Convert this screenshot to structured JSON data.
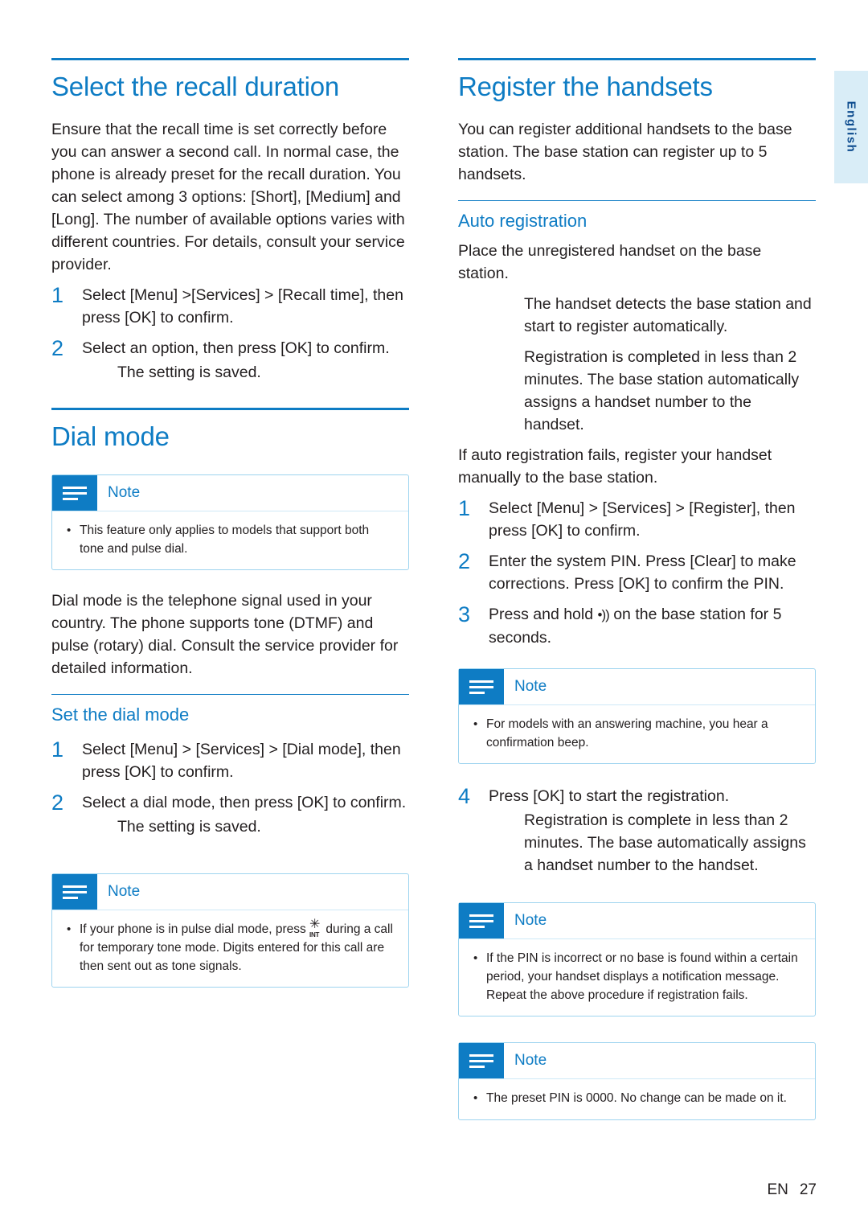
{
  "language_tab": "English",
  "footer": {
    "locale": "EN",
    "page": "27"
  },
  "note_label": "Note",
  "left_column": {
    "chapter_title": "Select the recall duration",
    "intro": "Ensure that the recall time is set correctly before you can answer a second call. In normal case, the phone is already preset for the recall duration. You can select among 3 options: [Short], [Medium] and [Long]. The number of available options varies with different countries. For details, consult your service provider.",
    "steps": [
      {
        "num": "1",
        "text": "Select [Menu] >[Services] > [Recall time], then press [OK] to confirm."
      },
      {
        "num": "2",
        "text": "Select an option, then press [OK] to confirm.",
        "sub": "The setting is saved."
      }
    ],
    "dial_mode_title": "Dial mode",
    "dial_note": "This feature only applies to models that support both tone and pulse dial.",
    "dial_body": "Dial mode is the telephone signal used in your country. The phone supports tone (DTMF) and pulse (rotary) dial. Consult the service provider for detailed information.",
    "set_dial_title": "Set the dial mode",
    "set_dial_steps": [
      {
        "num": "1",
        "text": "Select [Menu] > [Services] > [Dial mode], then press [OK] to confirm."
      },
      {
        "num": "2",
        "text": "Select a dial mode, then press [OK] to confirm.",
        "sub": "The setting is saved."
      }
    ],
    "pulse_note_part1": "If your phone is in pulse dial mode, press ",
    "pulse_note_part2": " during a call for temporary tone mode. Digits entered for this call are then sent out as tone signals."
  },
  "right_column": {
    "chapter_title": "Register the handsets",
    "intro": "You can register additional handsets to the base station. The base station can register up to 5 handsets.",
    "auto_title": "Auto registration",
    "auto_intro": "Place the unregistered handset on the base station.",
    "auto_indent_1": "The handset detects the base station and start to register automatically.",
    "auto_indent_2": "Registration is completed in less than 2 minutes. The base station automatically assigns a handset number to the handset.",
    "manual_intro": "If auto registration fails, register your handset manually to the base station.",
    "manual_steps": [
      {
        "num": "1",
        "text": "Select [Menu] > [Services] > [Register], then press [OK] to confirm."
      },
      {
        "num": "2",
        "text": "Enter the system PIN. Press [Clear] to make corrections. Press [OK] to confirm the PIN."
      }
    ],
    "step3_num": "3",
    "step3_part1": "Press and hold ",
    "step3_part2": " on the base station for 5 seconds.",
    "note_answering": "For models with an answering machine, you hear a confirmation beep.",
    "step4": {
      "num": "4",
      "text": "Press [OK] to start the registration.",
      "sub": "Registration is complete in less than 2 minutes. The base automatically assigns a handset number to the handset."
    },
    "note_pin_incorrect": "If the PIN is incorrect or no base is found within a certain period, your handset displays a notification message. Repeat the above procedure if registration fails.",
    "note_preset_pin": "The preset PIN is 0000. No change can be made on it."
  }
}
